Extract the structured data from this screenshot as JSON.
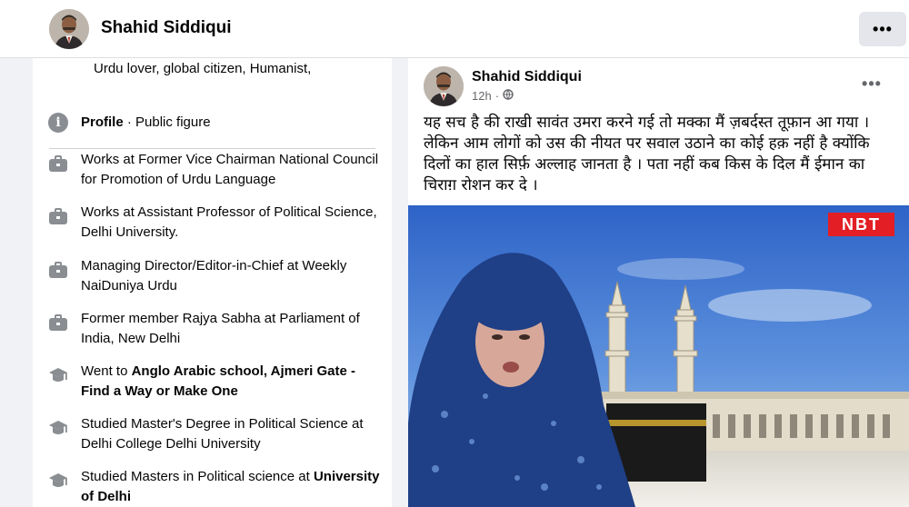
{
  "header": {
    "profile_name": "Shahid Siddiqui",
    "more_label": "•••"
  },
  "intro": {
    "bio": "Urdu lover, global citizen, Humanist,",
    "items": [
      {
        "icon": "info-icon",
        "text": "",
        "bold": "Profile",
        "after": " · Public figure"
      },
      {
        "icon": "briefcase-icon",
        "text": "Works at Former Vice Chairman National Council for Promotion of Urdu Language"
      },
      {
        "icon": "briefcase-icon",
        "text": "Works at Assistant Professor of Political Science, Delhi University."
      },
      {
        "icon": "briefcase-icon",
        "text": "Managing Director/Editor-in-Chief at Weekly NaiDuniya Urdu"
      },
      {
        "icon": "briefcase-icon",
        "text": "Former member Rajya Sabha at Parliament of India, New Delhi"
      },
      {
        "icon": "graduation-cap-icon",
        "text": "Went to ",
        "bold": "Anglo Arabic school, Ajmeri Gate - Find a Way or Make One"
      },
      {
        "icon": "graduation-cap-icon",
        "text": "Studied Master's Degree in Political Science at Delhi College Delhi University"
      },
      {
        "icon": "graduation-cap-icon",
        "text": "Studied Masters in Political science at ",
        "bold": "University of Delhi"
      }
    ]
  },
  "post": {
    "author": "Shahid Siddiqui",
    "time": "12h",
    "dot": "·",
    "more_label": "•••",
    "text": "यह सच है की राखी सावंत उमरा करने गई तो मक्का मैं ज़बर्दस्त तूफ़ान आ गया । लेकिन आम लोगों को उस की नीयत पर सवाल उठाने का कोई हक़ नहीं है क्योंकि दिलों का हाल सिर्फ़ अल्लाह जानता है । पता नहीं कब किस के दिल मैं ईमान का चिराग़ रोशन कर दे ।",
    "image_watermark": "NBT"
  },
  "colors": {
    "page_bg": "#f0f2f5",
    "card_bg": "#ffffff",
    "icon_gray": "#8a8d91",
    "secondary_text": "#65676b",
    "nbt_red": "#e31e25"
  }
}
